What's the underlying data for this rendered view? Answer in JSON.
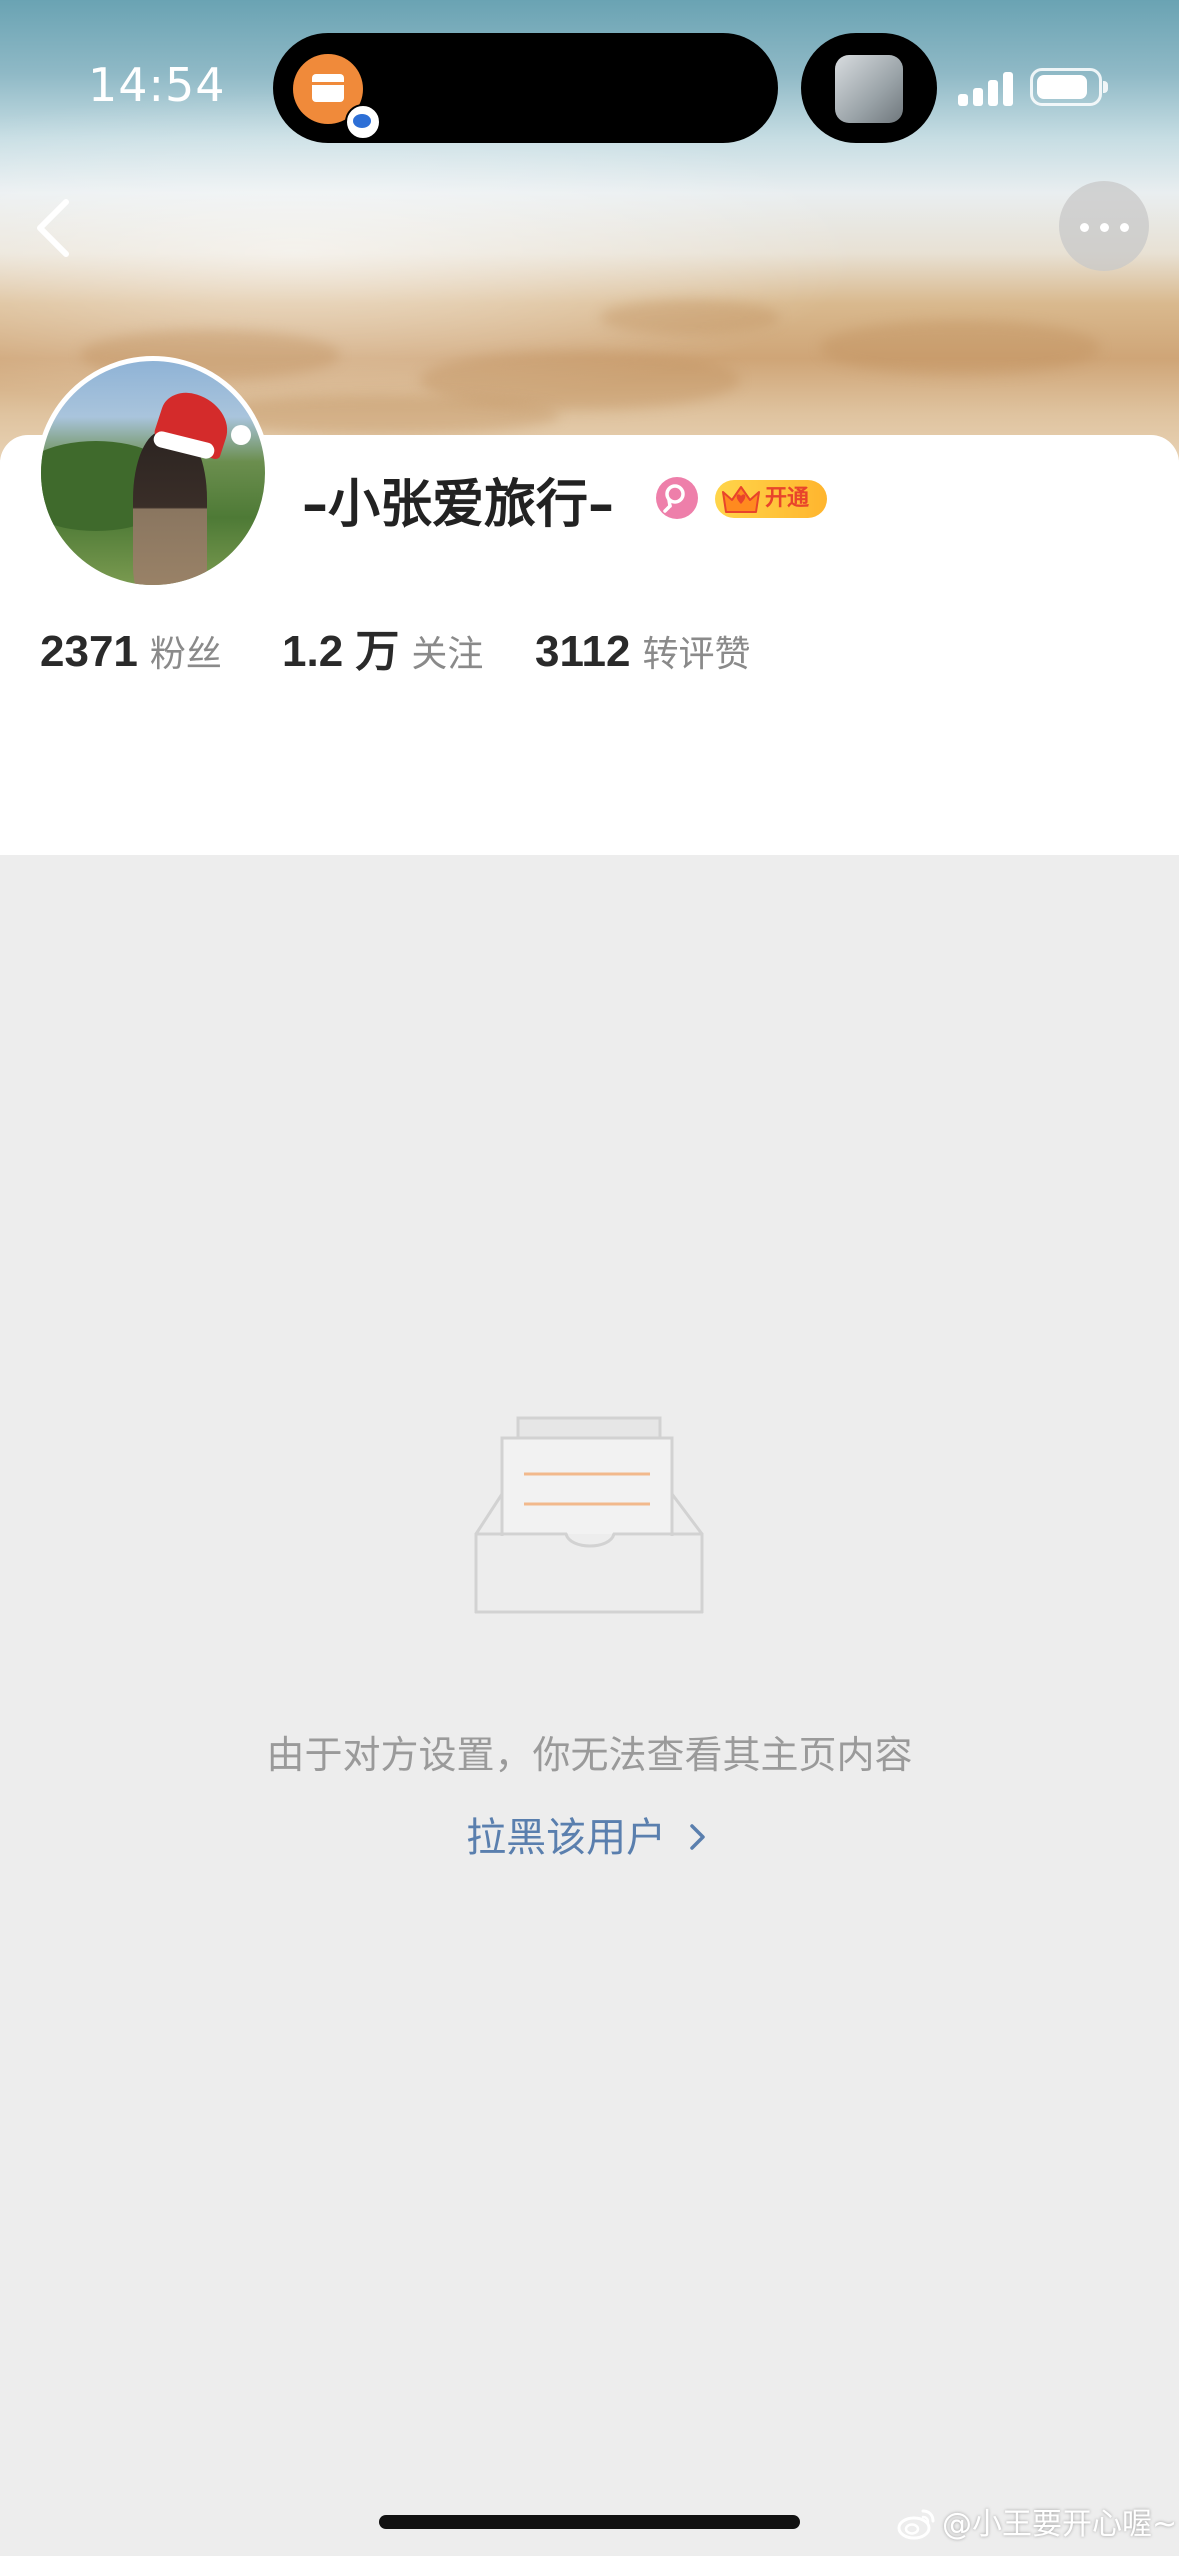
{
  "status_bar": {
    "time": "14:54"
  },
  "profile": {
    "username": "–小张爱旅行–",
    "vip_label": "开通",
    "stats": [
      {
        "value": "2371",
        "label": "粉丝"
      },
      {
        "value": "1.2 万",
        "label": "关注"
      },
      {
        "value": "3112",
        "label": "转评赞"
      }
    ]
  },
  "empty_state": {
    "message": "由于对方设置，你无法查看其主页内容",
    "action_label": "拉黑该用户",
    "action_icon": "chevron-right-icon"
  },
  "watermark": {
    "text": "@小王要开心喔~"
  },
  "colors": {
    "link": "#5a7fae",
    "gender_female": "#ee7faa",
    "vip_gold": "#ffc43d",
    "page_background": "#ededed"
  }
}
